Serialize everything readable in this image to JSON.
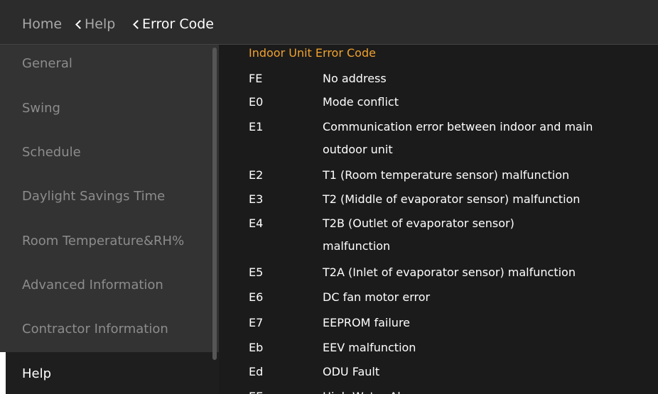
{
  "breadcrumb": {
    "home": "Home",
    "help": "Help",
    "current": "Error Code"
  },
  "sidebar": {
    "items": [
      {
        "label": "General"
      },
      {
        "label": "Swing"
      },
      {
        "label": "Schedule"
      },
      {
        "label": "Daylight Savings Time"
      },
      {
        "label": "Room Temperature&RH%"
      },
      {
        "label": "Advanced Information"
      },
      {
        "label": "Contractor Information"
      },
      {
        "label": "Help"
      }
    ],
    "active_item": "Help"
  },
  "content": {
    "title": "Indoor Unit Error Code",
    "errors": [
      {
        "code": "FE",
        "desc": "No address"
      },
      {
        "code": "E0",
        "desc": "Mode conflict"
      },
      {
        "code": "E1",
        "desc": "Communication error between indoor and main outdoor unit"
      },
      {
        "code": "E2",
        "desc": "T1 (Room temperature sensor) malfunction"
      },
      {
        "code": "E3",
        "desc": "T2 (Middle of evaporator sensor) malfunction"
      },
      {
        "code": "E4",
        "desc": "T2B (Outlet of evaporator sensor) malfunction"
      },
      {
        "code": "E5",
        "desc": "T2A (Inlet of evaporator sensor) malfunction"
      },
      {
        "code": "E6",
        "desc": "DC fan motor error"
      },
      {
        "code": "E7",
        "desc": "EEPROM failure"
      },
      {
        "code": "Eb",
        "desc": "EEV malfunction"
      },
      {
        "code": "Ed",
        "desc": "ODU Fault"
      },
      {
        "code": "EE",
        "desc": "High Water Alarm"
      }
    ]
  },
  "colors": {
    "header_bg": "#2c2c2c",
    "sidebar_bg": "#333333",
    "content_bg": "#1b1b1b",
    "accent": "#f0a22e",
    "active_text": "#ffffff",
    "inactive_text": "#8c8c8c"
  }
}
